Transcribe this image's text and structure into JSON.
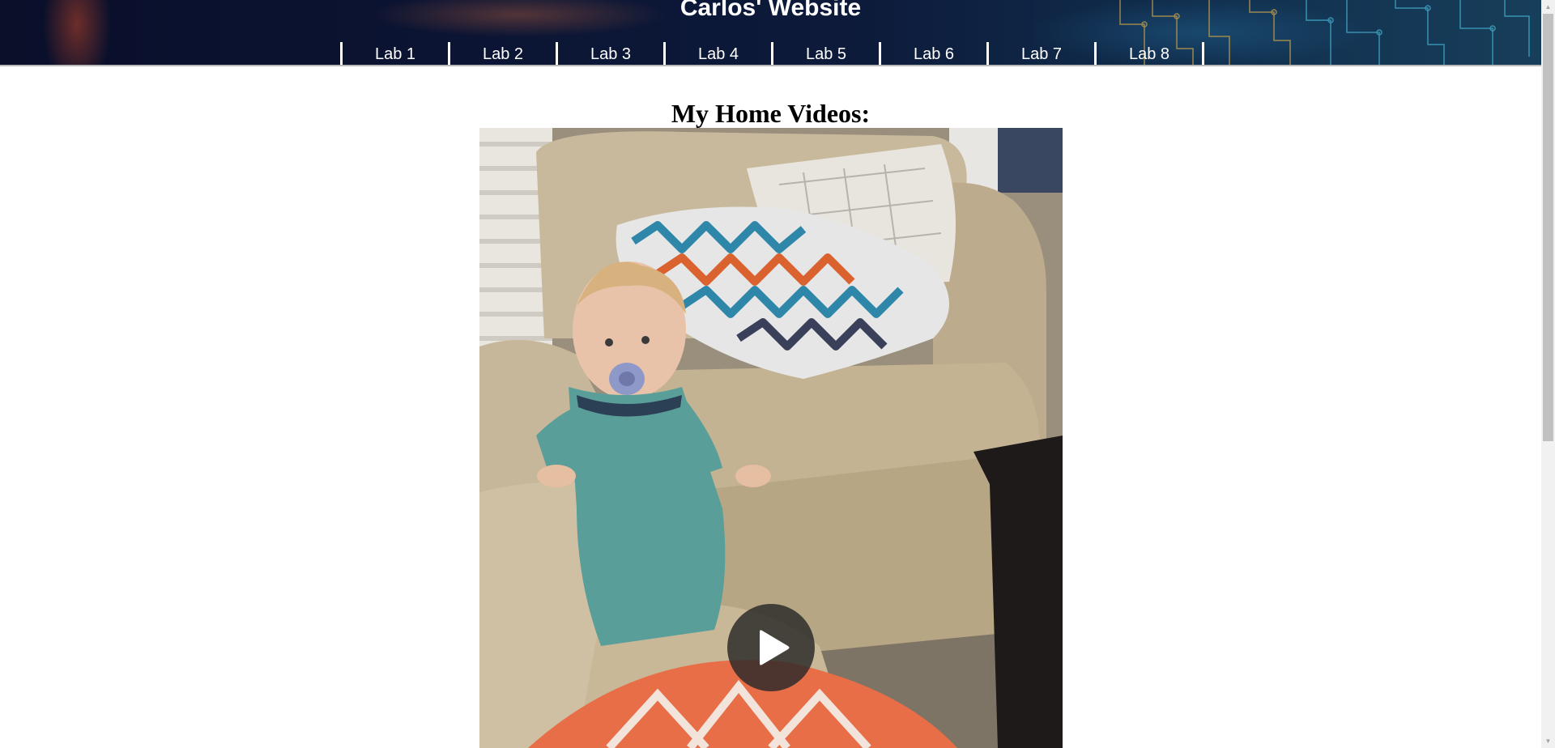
{
  "header": {
    "title": "Carlos' Website",
    "nav": [
      {
        "label": "Lab 1"
      },
      {
        "label": "Lab 2"
      },
      {
        "label": "Lab 3"
      },
      {
        "label": "Lab 4"
      },
      {
        "label": "Lab 5"
      },
      {
        "label": "Lab 6"
      },
      {
        "label": "Lab 7"
      },
      {
        "label": "Lab 8"
      }
    ]
  },
  "main": {
    "heading": "My Home Videos:",
    "video": {
      "thumbnail_subject": "toddler-standing-by-armchair",
      "play_icon": "play-icon"
    }
  },
  "colors": {
    "header_bg": "#0b1433",
    "nav_text": "#ffffff",
    "heading_text": "#000000"
  }
}
